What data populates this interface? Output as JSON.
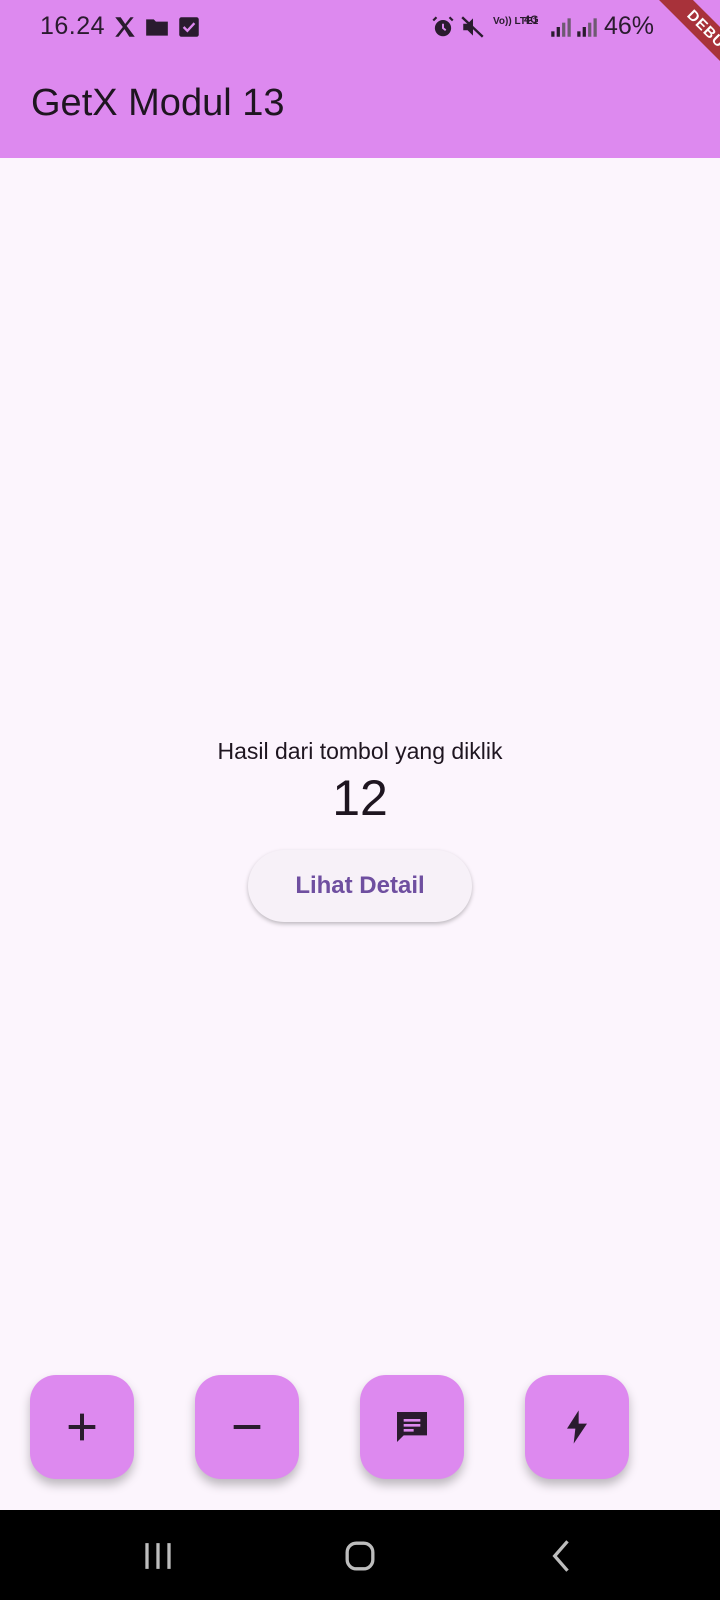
{
  "status_bar": {
    "time": "16.24",
    "battery": "46%",
    "volte_label": "Vo)) LTE1",
    "network_label": "4G",
    "icons": [
      "x-logo-icon",
      "folder-icon",
      "checkbox-icon",
      "alarm-icon",
      "mute-icon",
      "volte-icon",
      "network-4g-icon",
      "signal-icon",
      "signal-icon",
      "battery-icon"
    ]
  },
  "app_bar": {
    "title": "GetX Modul 13",
    "debug_banner": "DEBUG"
  },
  "main": {
    "label": "Hasil dari tombol yang diklik",
    "value": "12",
    "detail_button": "Lihat Detail"
  },
  "fabs": [
    {
      "icon": "plus-icon"
    },
    {
      "icon": "minus-icon"
    },
    {
      "icon": "message-icon"
    },
    {
      "icon": "bolt-icon"
    }
  ],
  "nav_bar": {
    "icons": [
      "recent-apps-icon",
      "home-icon",
      "back-icon"
    ]
  },
  "colors": {
    "app_bar": "#dd89ef",
    "background": "#fcf5fd",
    "button_text": "#6f4fa0",
    "fab": "#dd89ef",
    "debug_banner": "#a8323a",
    "nav_bar": "#000000"
  }
}
